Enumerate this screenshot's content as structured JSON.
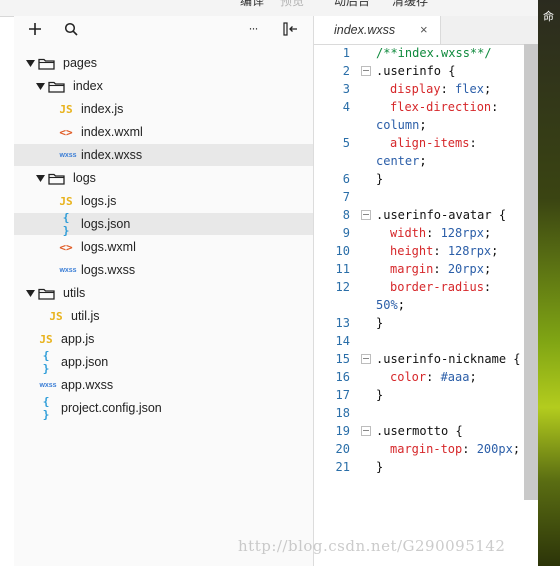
{
  "toolbar": {
    "compile": "编译",
    "preview": "预览",
    "remote_debug": "动后台",
    "clear_cache": "清缓存"
  },
  "explorer": {
    "add_icon": "plus-icon",
    "search_icon": "search-icon",
    "more_label": "···",
    "collapse_icon": "collapse-panel-icon",
    "tree": [
      {
        "label": "pages",
        "type": "folder",
        "open": true
      },
      {
        "label": "index",
        "type": "folder",
        "open": true
      },
      {
        "label": "index.js",
        "type": "js"
      },
      {
        "label": "index.wxml",
        "type": "wxml"
      },
      {
        "label": "index.wxss",
        "type": "wxss",
        "selected": true
      },
      {
        "label": "logs",
        "type": "folder",
        "open": true
      },
      {
        "label": "logs.js",
        "type": "js"
      },
      {
        "label": "logs.json",
        "type": "json",
        "selected": true
      },
      {
        "label": "logs.wxml",
        "type": "wxml"
      },
      {
        "label": "logs.wxss",
        "type": "wxss"
      },
      {
        "label": "utils",
        "type": "folder",
        "open": true
      },
      {
        "label": "util.js",
        "type": "js"
      },
      {
        "label": "app.js",
        "type": "js"
      },
      {
        "label": "app.json",
        "type": "json"
      },
      {
        "label": "app.wxss",
        "type": "wxss"
      },
      {
        "label": "project.config.json",
        "type": "json"
      }
    ],
    "glyphs": {
      "js": "JS",
      "wxml": "<>",
      "json": "{ }",
      "wxss": "wxss"
    }
  },
  "editor": {
    "tab_label": "index.wxss",
    "tab_close": "×",
    "line_numbers": [
      "1",
      "2",
      "3",
      "4",
      "5",
      "6",
      "7",
      "8",
      "9",
      "10",
      "11",
      "12",
      "13",
      "14",
      "15",
      "16",
      "17",
      "18",
      "19",
      "20",
      "21"
    ],
    "code": {
      "l1": "/**index.wxss**/",
      "l2": ".userinfo {",
      "l3p": "display",
      "l3v": "flex",
      "l4p": "flex-direction",
      "l4v": "column",
      "l5p": "align-items",
      "l5v": "center",
      "l8": ".userinfo-avatar {",
      "l9p": "width",
      "l9v": "128rpx",
      "l10p": "height",
      "l10v": "128rpx",
      "l11p": "margin",
      "l11v": "20rpx",
      "l12p": "border-radius",
      "l12v": "50%",
      "l15": ".userinfo-nickname {",
      "l16p": "color",
      "l16v": "#aaa",
      "l19": ".usermotto {",
      "l20p": "margin-top",
      "l20v": "200px",
      "close": "}"
    }
  },
  "desktop": {
    "label": "命"
  },
  "watermark": "http://blog.csdn.net/G290095142"
}
